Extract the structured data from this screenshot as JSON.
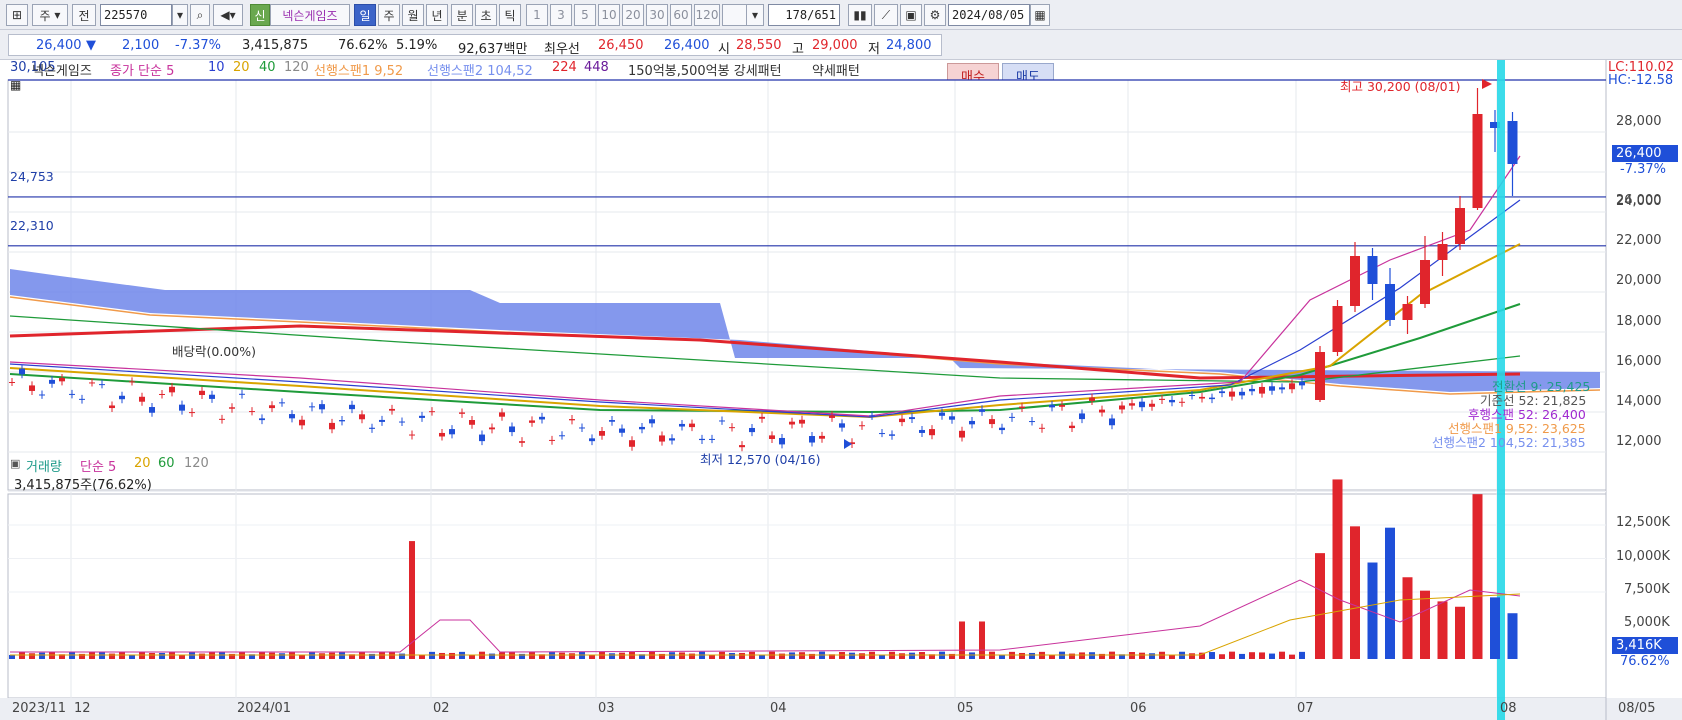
{
  "toolbar": {
    "type_sel": "주",
    "prev_label": "전",
    "code": "225570",
    "badge": "신",
    "name": "넥슨게임즈",
    "periods": [
      "일",
      "주",
      "월",
      "년",
      "분",
      "초",
      "틱"
    ],
    "active_period": "일",
    "intervals": [
      "1",
      "3",
      "5",
      "10",
      "20",
      "30",
      "60",
      "120"
    ],
    "page_counter": "178/651",
    "date": "2024/08/05"
  },
  "quote": {
    "price": "26,400",
    "arrow": "▼",
    "change": "2,100",
    "pct": "-7.37%",
    "volume": "3,415,875",
    "vol_ratio": "76.62%",
    "turnover": "5.19%",
    "amount": "92,637백만",
    "best_label": "최우선",
    "ask": "26,450",
    "bid": "26,400",
    "open_label": "시",
    "open": "28,550",
    "high_label": "고",
    "high": "29,000",
    "low_label": "저",
    "low": "24,800",
    "buy": "매수",
    "sell": "매도"
  },
  "legend": {
    "top_value": "30,105",
    "name": "넥슨게임즈",
    "series": [
      "종가 단순 5",
      "10",
      "20",
      "40",
      "120",
      "선행스팬1 9,52",
      "선행스팬2 104,52",
      "224",
      "448"
    ],
    "series_colors": [
      "#c8329c",
      "#2a3fd0",
      "#d9a400",
      "#1f9b3a",
      "#8a8a8a",
      "#f09a4a",
      "#7790ee",
      "#e0252c",
      "#6a1b9a"
    ],
    "patterns": "150억봉,500억봉 강세패턴",
    "weak": "약세패턴"
  },
  "price_panel": {
    "levels": [
      "24,753",
      "22,310"
    ],
    "high_note": "최고 30,200 (08/01)",
    "low_note": "최저 12,570 (04/16)",
    "dividend": "배당락(0.00%)",
    "lc": "LC:110.02",
    "hc": "HC:-12.58",
    "last_price": "26,400",
    "last_pct": "-7.37%",
    "y_ticks": [
      "28,000",
      "26,000",
      "24,000",
      "22,000",
      "20,000",
      "18,000",
      "16,000",
      "14,000",
      "12,000"
    ],
    "ichimoku": [
      {
        "text": "전환선 9: 25,425",
        "color": "#1f9b8a"
      },
      {
        "text": "기준선 52: 21,825",
        "color": "#555555"
      },
      {
        "text": "후행스팬 52: 26,400",
        "color": "#a02ad0"
      },
      {
        "text": "선행스팬1 9,52: 23,625",
        "color": "#f09a4a"
      },
      {
        "text": "선행스팬2 104,52: 21,385",
        "color": "#7790ee"
      }
    ]
  },
  "volume_panel": {
    "legend_series": [
      "거래량",
      "단순 5",
      "20",
      "60",
      "120"
    ],
    "legend_colors": [
      "#1f9b8a",
      "#c8329c",
      "#d9a400",
      "#1f9b3a",
      "#8a8a8a"
    ],
    "volume_text": "3,415,875주(76.62%)",
    "y_ticks": [
      "12,500K",
      "10,000K",
      "7,500K",
      "5,000K"
    ],
    "last_value": "3,416K",
    "last_pct": "76.62%"
  },
  "x_axis": [
    "2023/11",
    "12",
    "2024/01",
    "02",
    "03",
    "04",
    "05",
    "06",
    "07",
    "08",
    "08/05"
  ],
  "colors": {
    "up": "#e0252c",
    "down": "#1f4fd8",
    "cloud": "#6f86ea",
    "cursor": "#27d8e8"
  },
  "chart_data": {
    "type": "candlestick",
    "period": "daily",
    "y_range": [
      11800,
      30500
    ],
    "last_close": 26400,
    "high": {
      "value": 30200,
      "date": "08/01"
    },
    "low": {
      "value": 12570,
      "date": "04/16"
    },
    "horizontal_levels": [
      24753,
      22310
    ],
    "recent_candles": [
      {
        "o": 14600,
        "h": 17300,
        "l": 14500,
        "c": 17000
      },
      {
        "o": 17000,
        "h": 19600,
        "l": 16800,
        "c": 19300
      },
      {
        "o": 19300,
        "h": 22500,
        "l": 19000,
        "c": 21800
      },
      {
        "o": 21800,
        "h": 22200,
        "l": 19600,
        "c": 20400
      },
      {
        "o": 20400,
        "h": 21200,
        "l": 18300,
        "c": 18600
      },
      {
        "o": 18600,
        "h": 19800,
        "l": 17900,
        "c": 19400
      },
      {
        "o": 19400,
        "h": 22800,
        "l": 19200,
        "c": 21600
      },
      {
        "o": 21600,
        "h": 23000,
        "l": 20800,
        "c": 22400
      },
      {
        "o": 22400,
        "h": 24800,
        "l": 22100,
        "c": 24200
      },
      {
        "o": 24200,
        "h": 30200,
        "l": 24100,
        "c": 28900
      },
      {
        "o": 28500,
        "h": 29100,
        "l": 27000,
        "c": 28200
      },
      {
        "o": 28550,
        "h": 29000,
        "l": 24800,
        "c": 26400
      }
    ],
    "volume_recent_k": [
      7900,
      13400,
      9900,
      7200,
      9800,
      6100,
      5100,
      4300,
      3900,
      12300,
      4600,
      3416
    ],
    "volume_y_range": [
      0,
      14000
    ]
  }
}
